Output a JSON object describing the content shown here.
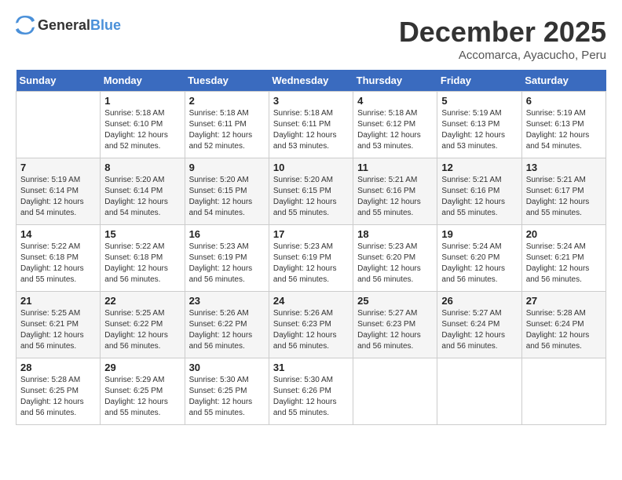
{
  "header": {
    "logo_general": "General",
    "logo_blue": "Blue",
    "title": "December 2025",
    "subtitle": "Accomarca, Ayacucho, Peru"
  },
  "calendar": {
    "weekdays": [
      "Sunday",
      "Monday",
      "Tuesday",
      "Wednesday",
      "Thursday",
      "Friday",
      "Saturday"
    ],
    "weeks": [
      [
        {
          "day": "",
          "info": ""
        },
        {
          "day": "1",
          "info": "Sunrise: 5:18 AM\nSunset: 6:10 PM\nDaylight: 12 hours\nand 52 minutes."
        },
        {
          "day": "2",
          "info": "Sunrise: 5:18 AM\nSunset: 6:11 PM\nDaylight: 12 hours\nand 52 minutes."
        },
        {
          "day": "3",
          "info": "Sunrise: 5:18 AM\nSunset: 6:11 PM\nDaylight: 12 hours\nand 53 minutes."
        },
        {
          "day": "4",
          "info": "Sunrise: 5:18 AM\nSunset: 6:12 PM\nDaylight: 12 hours\nand 53 minutes."
        },
        {
          "day": "5",
          "info": "Sunrise: 5:19 AM\nSunset: 6:13 PM\nDaylight: 12 hours\nand 53 minutes."
        },
        {
          "day": "6",
          "info": "Sunrise: 5:19 AM\nSunset: 6:13 PM\nDaylight: 12 hours\nand 54 minutes."
        }
      ],
      [
        {
          "day": "7",
          "info": "Sunrise: 5:19 AM\nSunset: 6:14 PM\nDaylight: 12 hours\nand 54 minutes."
        },
        {
          "day": "8",
          "info": "Sunrise: 5:20 AM\nSunset: 6:14 PM\nDaylight: 12 hours\nand 54 minutes."
        },
        {
          "day": "9",
          "info": "Sunrise: 5:20 AM\nSunset: 6:15 PM\nDaylight: 12 hours\nand 54 minutes."
        },
        {
          "day": "10",
          "info": "Sunrise: 5:20 AM\nSunset: 6:15 PM\nDaylight: 12 hours\nand 55 minutes."
        },
        {
          "day": "11",
          "info": "Sunrise: 5:21 AM\nSunset: 6:16 PM\nDaylight: 12 hours\nand 55 minutes."
        },
        {
          "day": "12",
          "info": "Sunrise: 5:21 AM\nSunset: 6:16 PM\nDaylight: 12 hours\nand 55 minutes."
        },
        {
          "day": "13",
          "info": "Sunrise: 5:21 AM\nSunset: 6:17 PM\nDaylight: 12 hours\nand 55 minutes."
        }
      ],
      [
        {
          "day": "14",
          "info": "Sunrise: 5:22 AM\nSunset: 6:18 PM\nDaylight: 12 hours\nand 55 minutes."
        },
        {
          "day": "15",
          "info": "Sunrise: 5:22 AM\nSunset: 6:18 PM\nDaylight: 12 hours\nand 56 minutes."
        },
        {
          "day": "16",
          "info": "Sunrise: 5:23 AM\nSunset: 6:19 PM\nDaylight: 12 hours\nand 56 minutes."
        },
        {
          "day": "17",
          "info": "Sunrise: 5:23 AM\nSunset: 6:19 PM\nDaylight: 12 hours\nand 56 minutes."
        },
        {
          "day": "18",
          "info": "Sunrise: 5:23 AM\nSunset: 6:20 PM\nDaylight: 12 hours\nand 56 minutes."
        },
        {
          "day": "19",
          "info": "Sunrise: 5:24 AM\nSunset: 6:20 PM\nDaylight: 12 hours\nand 56 minutes."
        },
        {
          "day": "20",
          "info": "Sunrise: 5:24 AM\nSunset: 6:21 PM\nDaylight: 12 hours\nand 56 minutes."
        }
      ],
      [
        {
          "day": "21",
          "info": "Sunrise: 5:25 AM\nSunset: 6:21 PM\nDaylight: 12 hours\nand 56 minutes."
        },
        {
          "day": "22",
          "info": "Sunrise: 5:25 AM\nSunset: 6:22 PM\nDaylight: 12 hours\nand 56 minutes."
        },
        {
          "day": "23",
          "info": "Sunrise: 5:26 AM\nSunset: 6:22 PM\nDaylight: 12 hours\nand 56 minutes."
        },
        {
          "day": "24",
          "info": "Sunrise: 5:26 AM\nSunset: 6:23 PM\nDaylight: 12 hours\nand 56 minutes."
        },
        {
          "day": "25",
          "info": "Sunrise: 5:27 AM\nSunset: 6:23 PM\nDaylight: 12 hours\nand 56 minutes."
        },
        {
          "day": "26",
          "info": "Sunrise: 5:27 AM\nSunset: 6:24 PM\nDaylight: 12 hours\nand 56 minutes."
        },
        {
          "day": "27",
          "info": "Sunrise: 5:28 AM\nSunset: 6:24 PM\nDaylight: 12 hours\nand 56 minutes."
        }
      ],
      [
        {
          "day": "28",
          "info": "Sunrise: 5:28 AM\nSunset: 6:25 PM\nDaylight: 12 hours\nand 56 minutes."
        },
        {
          "day": "29",
          "info": "Sunrise: 5:29 AM\nSunset: 6:25 PM\nDaylight: 12 hours\nand 55 minutes."
        },
        {
          "day": "30",
          "info": "Sunrise: 5:30 AM\nSunset: 6:25 PM\nDaylight: 12 hours\nand 55 minutes."
        },
        {
          "day": "31",
          "info": "Sunrise: 5:30 AM\nSunset: 6:26 PM\nDaylight: 12 hours\nand 55 minutes."
        },
        {
          "day": "",
          "info": ""
        },
        {
          "day": "",
          "info": ""
        },
        {
          "day": "",
          "info": ""
        }
      ]
    ]
  }
}
